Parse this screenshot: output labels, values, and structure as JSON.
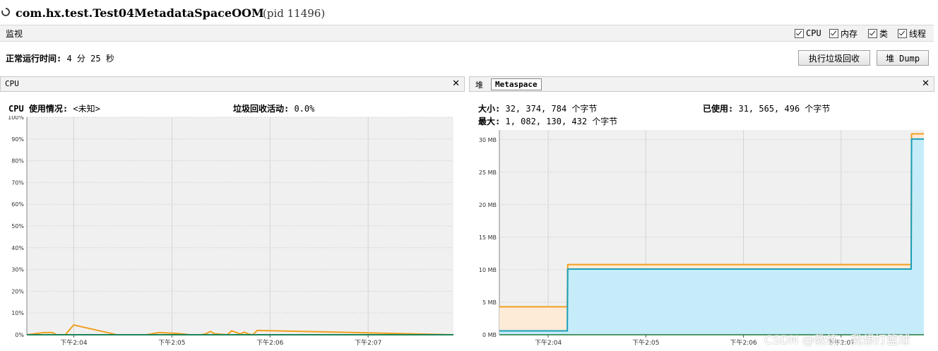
{
  "window": {
    "title": "com.hx.test.Test04MetadataSpaceOOM",
    "pid": "(pid 11496)"
  },
  "monitor": {
    "label": "监视",
    "checkboxes": [
      {
        "label": "CPU",
        "checked": true
      },
      {
        "label": "内存",
        "checked": true
      },
      {
        "label": "类",
        "checked": true
      },
      {
        "label": "线程",
        "checked": true
      }
    ]
  },
  "uptime": {
    "label": "正常运行时间:",
    "value": "4 分 25 秒"
  },
  "buttons": {
    "gc": "执行垃圾回收",
    "heap_dump": "堆 Dump"
  },
  "cpu_panel": {
    "title": "CPU",
    "close": "✕",
    "usage_label": "CPU 使用情况:",
    "usage_value": "<未知>",
    "gc_label": "垃圾回收活动:",
    "gc_value": "0.0%"
  },
  "mem_panel": {
    "tabs": [
      "堆",
      "Metaspace"
    ],
    "active_tab": "Metaspace",
    "close": "✕",
    "size_label": "大小:",
    "size_value": "32, 374, 784 个字节",
    "used_label": "已使用:",
    "used_value": "31, 565, 496 个字节",
    "max_label": "最大:",
    "max_value": "1, 082, 130, 432 个字节"
  },
  "chart_data": [
    {
      "type": "line",
      "title": "",
      "xlabel": "",
      "ylabel": "",
      "x_ticks": [
        "下午2:04",
        "下午2:05",
        "下午2:06",
        "下午2:07"
      ],
      "y_ticks": [
        "0%",
        "10%",
        "20%",
        "30%",
        "40%",
        "50%",
        "60%",
        "70%",
        "80%",
        "90%",
        "100%"
      ],
      "ylim": [
        0,
        100
      ],
      "grid": true,
      "series": [
        {
          "color": "#f0a020",
          "x": [
            0,
            0.04,
            0.06,
            0.07,
            0.09,
            0.11,
            0.2,
            0.21,
            0.23,
            0.28,
            0.31,
            0.33,
            0.345,
            0.36,
            0.37,
            0.38,
            0.395,
            0.41,
            0.42,
            0.43,
            0.44,
            0.47,
            0.48,
            0.5,
            0.51,
            0.52,
            0.53,
            0.54,
            1.0
          ],
          "y": [
            0,
            1,
            1,
            0,
            0,
            4.5,
            0.5,
            0,
            0,
            0,
            1,
            0.8,
            0.7,
            0.5,
            0.3,
            0,
            0,
            0,
            0.5,
            1.5,
            0.5,
            0,
            1.8,
            0.4,
            1.2,
            0.3,
            0,
            2,
            0
          ]
        },
        {
          "color": "#1a9fb8",
          "x": [
            0,
            1.0
          ],
          "y": [
            0,
            0
          ]
        }
      ]
    },
    {
      "type": "area",
      "title": "",
      "xlabel": "",
      "ylabel": "",
      "x_ticks": [
        "下午2:04",
        "下午2:05",
        "下午2:06",
        "下午2:07"
      ],
      "y_ticks": [
        "0 MB",
        "5 MB",
        "10 MB",
        "15 MB",
        "20 MB",
        "25 MB",
        "30 MB"
      ],
      "ylim": [
        0,
        31.5
      ],
      "grid": true,
      "series": [
        {
          "name": "大小",
          "color": "#f0a020",
          "x": [
            0,
            0.16,
            0.161,
            0.97,
            0.971,
            1.0
          ],
          "y": [
            4.3,
            4.3,
            10.8,
            10.8,
            30.9,
            30.9
          ]
        },
        {
          "name": "已使用",
          "color": "#1a9fb8",
          "x": [
            0,
            0.16,
            0.161,
            0.97,
            0.971,
            1.0
          ],
          "y": [
            0.6,
            0.6,
            10.1,
            10.1,
            30.1,
            30.1
          ]
        }
      ]
    }
  ],
  "watermark": "CSDN @教练、我想打篮球"
}
